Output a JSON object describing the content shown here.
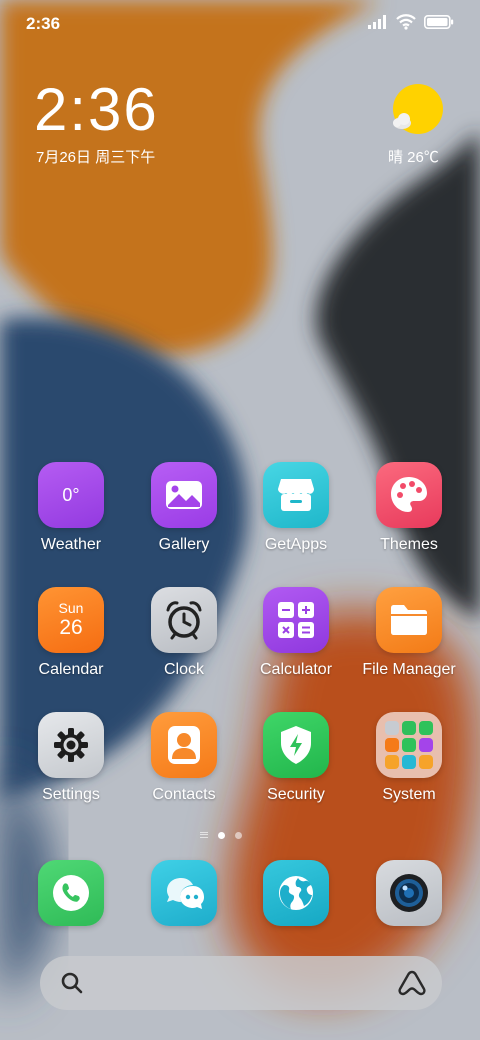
{
  "status_bar": {
    "time": "2:36",
    "icons": [
      "signal-icon",
      "wifi-icon",
      "battery-icon"
    ]
  },
  "clock_widget": {
    "time": "2:36",
    "date": "7月26日 周三下午"
  },
  "weather_widget": {
    "icon": "sun-cloud-icon",
    "text": "晴 26℃"
  },
  "apps": [
    {
      "label": "Weather",
      "icon": "weather-icon",
      "icon_text": "0°",
      "color": "#a84ee8"
    },
    {
      "label": "Gallery",
      "icon": "gallery-icon",
      "color": "#a94cec"
    },
    {
      "label": "GetApps",
      "icon": "store-icon",
      "color": "#2ec8d8"
    },
    {
      "label": "Themes",
      "icon": "palette-icon",
      "color": "#f04e6a"
    },
    {
      "label": "Calendar",
      "icon": "calendar-icon",
      "icon_day": "Sun",
      "icon_date": "26",
      "color": "#fb7b20"
    },
    {
      "label": "Clock",
      "icon": "alarm-clock-icon",
      "color": "#c9ccd1"
    },
    {
      "label": "Calculator",
      "icon": "calculator-icon",
      "color": "#a34ae8"
    },
    {
      "label": "File Manager",
      "icon": "folder-icon",
      "color": "#fb8a22"
    },
    {
      "label": "Settings",
      "icon": "gear-icon",
      "color": "#d8dadd"
    },
    {
      "label": "Contacts",
      "icon": "contact-icon",
      "color": "#fb8a24"
    },
    {
      "label": "Security",
      "icon": "shield-icon",
      "color": "#2fc85a"
    },
    {
      "label": "System",
      "icon": "folder-grid-icon",
      "color": "#f2d4c8"
    }
  ],
  "dock": [
    {
      "icon": "phone-icon",
      "color": "#35c45a"
    },
    {
      "icon": "messages-icon",
      "color": "#28b9d6"
    },
    {
      "icon": "browser-icon",
      "color": "#20b6cf"
    },
    {
      "icon": "camera-icon",
      "color": "#c7cbd1"
    }
  ],
  "page_indicator": {
    "pages": 2,
    "active": 1
  },
  "search_bar": {
    "icons": [
      "search-icon",
      "assistant-icon"
    ]
  }
}
